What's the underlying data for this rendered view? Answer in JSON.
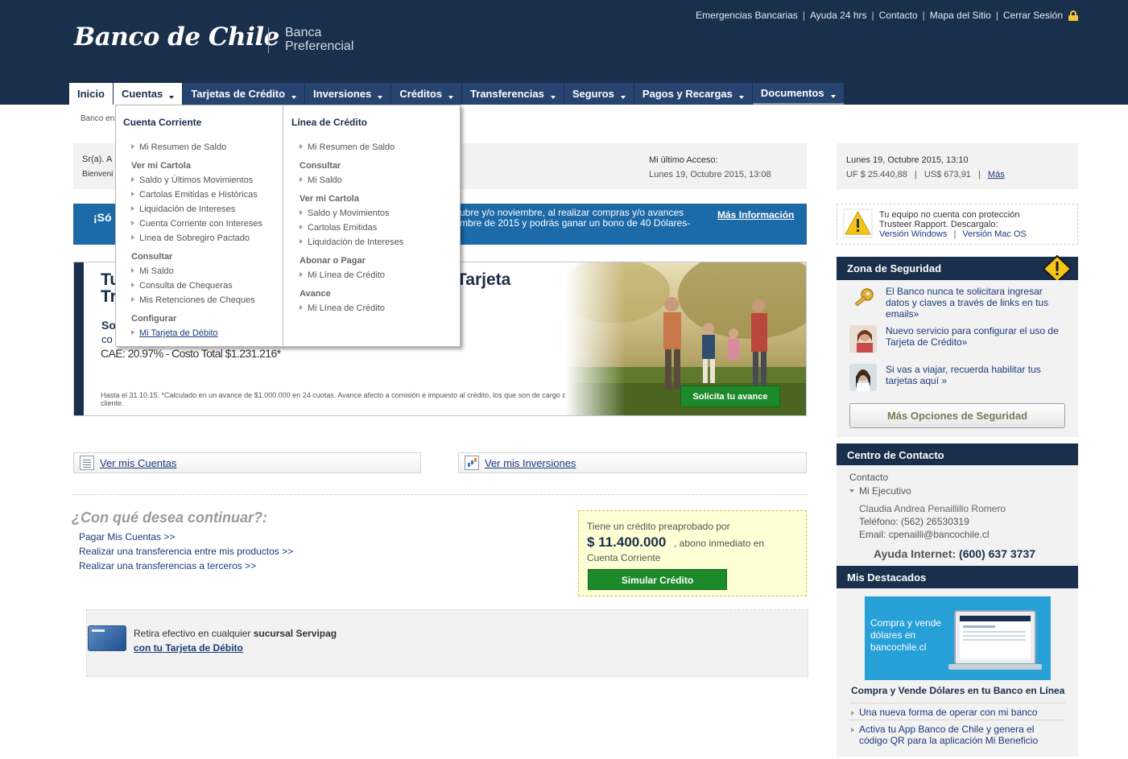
{
  "header": {
    "logo": "Banco de Chile",
    "tagline_line1": "Banca",
    "tagline_line2": "Preferencial",
    "top_links": [
      "Emergencias Bancarias",
      "Ayuda 24 hrs",
      "Contacto",
      "Mapa del Sitio",
      "Cerrar Sesión"
    ]
  },
  "nav": {
    "tabs": [
      "Inicio",
      "Cuentas",
      "Tarjetas de Crédito",
      "Inversiones",
      "Créditos",
      "Transferencias",
      "Seguros",
      "Pagos y Recargas",
      "Documentos"
    ],
    "selected": "Cuentas"
  },
  "breadcrumb": "Banco en",
  "dropdown": {
    "col1": {
      "heading": "Cuenta Corriente",
      "item_resumen": "Mi Resumen de Saldo",
      "group_cartola": "Ver mi Cartola",
      "cartola_items": [
        "Saldo y Últimos Movimientos",
        "Cartolas Emitidas e Históricas",
        "Liquidación de Intereses",
        "Cuenta Corriente con Intereses",
        "Línea de Sobregiro Pactado"
      ],
      "group_consultar": "Consultar",
      "consultar_items": [
        "Mi Saldo",
        "Consulta de Chequeras",
        "Mis Retenciones de Cheques"
      ],
      "group_configurar": "Configurar",
      "configurar_item": "Mi Tarjeta de Débito"
    },
    "col2": {
      "heading": "Línea de Crédito",
      "item_resumen": "Mi Resumen de Saldo",
      "group_consultar": "Consultar",
      "consultar_item": "Mi Saldo",
      "group_cartola": "Ver mi Cartola",
      "cartola_items": [
        "Saldo y Movimientos",
        "Cartolas Emitidas",
        "Liquidación de Intereses"
      ],
      "group_abonar": "Abonar o Pagar",
      "abonar_item": "Mi Línea de Crédito",
      "group_avance": "Avance",
      "avance_item": "Mi Línea de Crédito"
    }
  },
  "user": {
    "greeting": "Sr(a). A",
    "welcome": "Bienveni",
    "last_access_label": "Mi último Acceso:",
    "last_access_value": "Lunes 19, Octubre 2015, 13:08"
  },
  "promo": {
    "start": "¡Só",
    "line1": "ubre y/o noviembre, al realizar compras y/o avances",
    "line2": "mbre de 2015 y podrás ganar un bono de 40 Dólares-",
    "link": "Más Información"
  },
  "banner": {
    "title_a": "Tu",
    "title_b": "Tarjeta",
    "title_c": "Tr",
    "sub1": "So",
    "sub2": "co",
    "cae": "CAE: 20.97% - Costo Total $1.231.216*",
    "fine_print": "Hasta el 31.10.15. *Calculado en un avance de $1.000.000 en 24 cuotas. Avance afecto a comisión e impuesto al crédito, los que son de cargo del cliente.",
    "button": "Solicita tu avance"
  },
  "quick": {
    "cuentas": "Ver mis Cuentas",
    "inversiones": "Ver mis Inversiones"
  },
  "continue": {
    "title": "¿Con qué desea continuar?:",
    "links": [
      "Pagar Mis Cuentas >>",
      "Realizar una transferencia entre mis productos >>",
      "Realizar una transferencias a terceros >>"
    ]
  },
  "credit": {
    "line1": "Tiene un crédito preaprobado por",
    "amount": "$ 11.400.000",
    "tail": ", abono inmediato en",
    "line3": "Cuenta Corriente",
    "button": "Simular Crédito"
  },
  "servipag": {
    "text_plain": "Retira efectivo en cualquier ",
    "text_bold": "sucursal Servipag",
    "link": "con tu Tarjeta de Débito"
  },
  "right": {
    "date": "Lunes 19, Octubre 2015, 13:10",
    "uf": "UF $ 25.440,88",
    "usd": "US$ 673,91",
    "mas": "Más",
    "trusteer_l1": "Tu equipo no cuenta con protección",
    "trusteer_l2": "Trusteer Rapport. Descargalo:",
    "trusteer_win": "Versión Windows",
    "trusteer_mac": "Versión Mac OS",
    "security": {
      "title": "Zona de Seguridad",
      "items": [
        "El Banco nunca te solicitara ingresar datos y claves a través de links en tus emails»",
        "Nuevo servicio para configurar el uso de Tarjeta de Crédito»",
        "Si vas a viajar, recuerda habilitar tus tarjetas aquí »"
      ],
      "button": "Más Opciones de Seguridad"
    },
    "contact": {
      "title": "Centro de Contacto",
      "contacto": "Contacto",
      "ejecutivo": "Mi Ejecutivo",
      "name": "Claudia Andrea Penaillillo Romero",
      "phone": "Teléfono: (562) 26530319",
      "email": "Email: cpenailli@bancochile.cl",
      "help_label": "Ayuda Internet:",
      "help_number": "(600) 637 3737"
    },
    "featured": {
      "title": "Mis Destacados",
      "image_text": "Compra y vende dólares en bancochile.cl",
      "caption": "Compra y Vende Dólares en tu Banco en Línea",
      "links": [
        "Una nueva forma de operar con mi banco",
        "Activa tu App Banco de Chile y genera el código QR para la aplicación Mi Beneficio"
      ]
    }
  },
  "colors": {
    "header_navy": "#1a2f4b",
    "tab_blue": "#274470",
    "promo_blue": "#1d6aa8",
    "action_green": "#1c8a2a",
    "credit_yellow": "#ffffd6"
  }
}
